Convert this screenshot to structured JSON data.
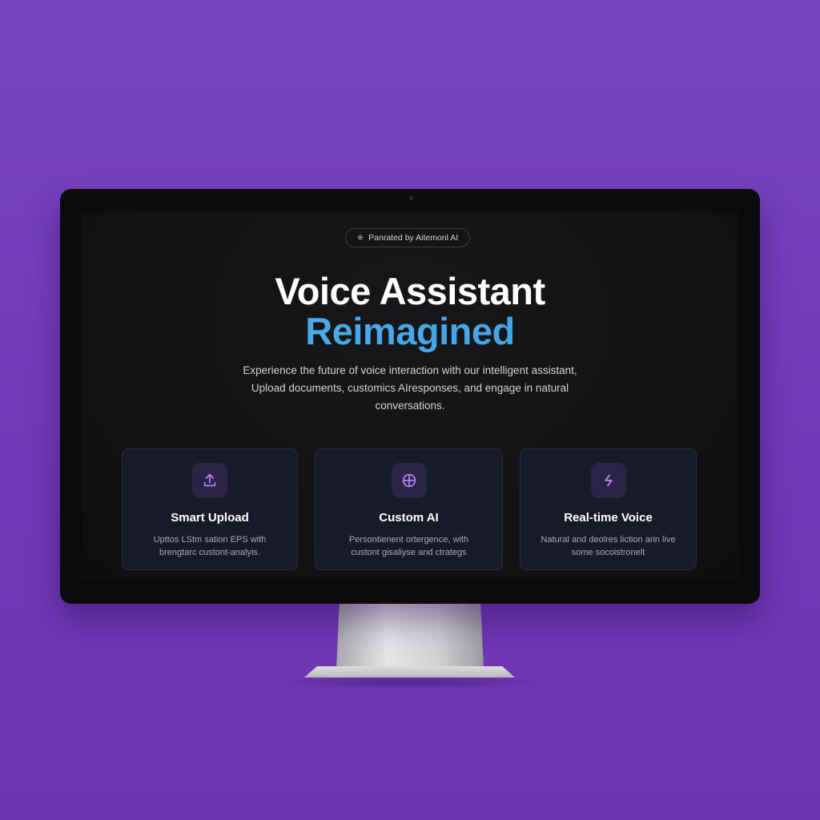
{
  "badge": {
    "icon": "sparkle-icon",
    "label": "Panrated by Aitemonl AI"
  },
  "hero": {
    "title_line1": "Voice Assistant",
    "title_line2": "Reimagined",
    "subtitle_lines": [
      "Experience the future of voice interaction with our intelligent assistant,",
      "Upload documents, customics AIresponses, and engage in natural",
      "conversations."
    ]
  },
  "colors": {
    "background": "#7a45c0",
    "accent": "#4aa8e8",
    "icon_accent": "#b57cf2",
    "card_bg": "#191a28"
  },
  "cards": [
    {
      "icon": "upload-icon",
      "title": "Smart Upload",
      "desc_lines": [
        "Upttos LStm sation EPS with",
        "brengtarc custont-analyis."
      ]
    },
    {
      "icon": "crosshair-icon",
      "title": "Custom AI",
      "desc_lines": [
        "Persontienent ortergence, with",
        "custont gisaliyse and ctrategs"
      ]
    },
    {
      "icon": "lightning-icon",
      "title": "Real-time Voice",
      "desc_lines": [
        "Natural and deolres liction arin live",
        "some socoistronelt"
      ]
    }
  ]
}
